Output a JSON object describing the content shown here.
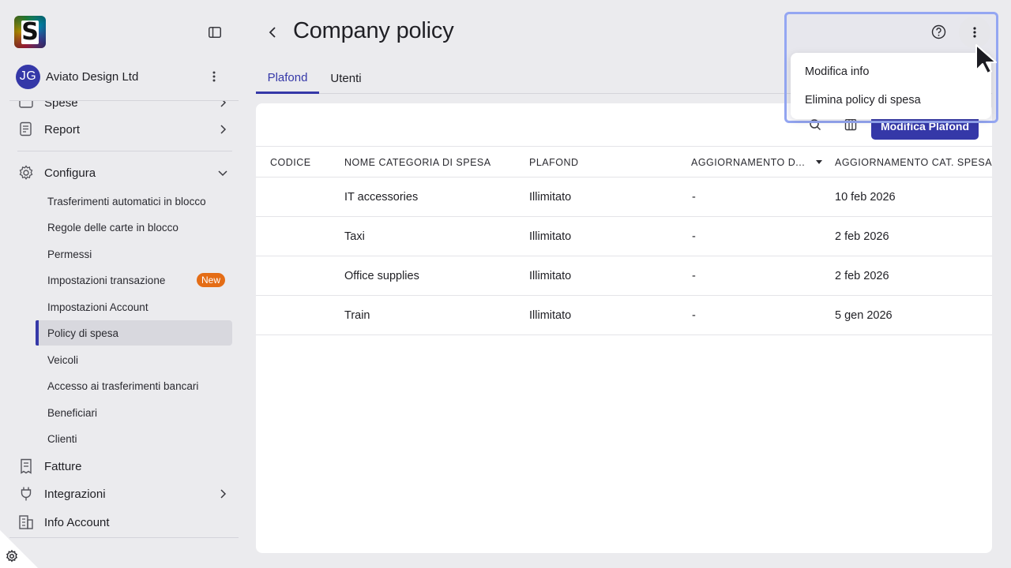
{
  "sidebar": {
    "logo_letter": "S",
    "company": {
      "avatar_initials": "JG",
      "name": "Aviato Design Ltd"
    },
    "nav": {
      "partial_label": "Spese",
      "report": "Report",
      "configura": "Configura",
      "fatture": "Fatture",
      "integrazioni": "Integrazioni",
      "info_account": "Info Account"
    },
    "sub_items": [
      "Trasferimenti automatici in blocco",
      "Regole delle carte in blocco",
      "Permessi",
      "Impostazioni transazione",
      "Impostazioni Account",
      "Policy di spesa",
      "Veicoli",
      "Accesso ai trasferimenti bancari",
      "Beneficiari",
      "Clienti"
    ],
    "new_badge": "New",
    "active_sub_item": "Policy di spesa"
  },
  "header": {
    "title": "Company policy"
  },
  "tabs": [
    {
      "label": "Plafond",
      "active": true
    },
    {
      "label": "Utenti",
      "active": false
    }
  ],
  "toolbar": {
    "primary_button": "Modifica Plafond"
  },
  "table": {
    "columns": [
      "CODICE",
      "NOME CATEGORIA DI SPESA",
      "PLAFOND",
      "AGGIORNAMENTO D...",
      "AGGIORNAMENTO CAT. SPESA"
    ],
    "rows": [
      {
        "codice": "",
        "nome": "IT accessories",
        "plafond": "Illimitato",
        "agg_d": "-",
        "agg_cat": "10 feb 2026"
      },
      {
        "codice": "",
        "nome": "Taxi",
        "plafond": "Illimitato",
        "agg_d": "-",
        "agg_cat": "2 feb 2026"
      },
      {
        "codice": "",
        "nome": "Office supplies",
        "plafond": "Illimitato",
        "agg_d": "-",
        "agg_cat": "2 feb 2026"
      },
      {
        "codice": "",
        "nome": "Train",
        "plafond": "Illimitato",
        "agg_d": "-",
        "agg_cat": "5 gen 2026"
      }
    ]
  },
  "dropdown": {
    "items": [
      "Modifica info",
      "Elimina policy di spesa"
    ]
  },
  "colors": {
    "accent": "#3538a8",
    "badge": "#e46d16",
    "highlight": "#94a6f2"
  },
  "icons": {
    "collapse": "sidebar-collapse-icon",
    "help": "help-circle-icon",
    "kebab": "more-vertical-icon",
    "search": "search-icon",
    "columns": "columns-icon",
    "settings": "gear-icon"
  }
}
